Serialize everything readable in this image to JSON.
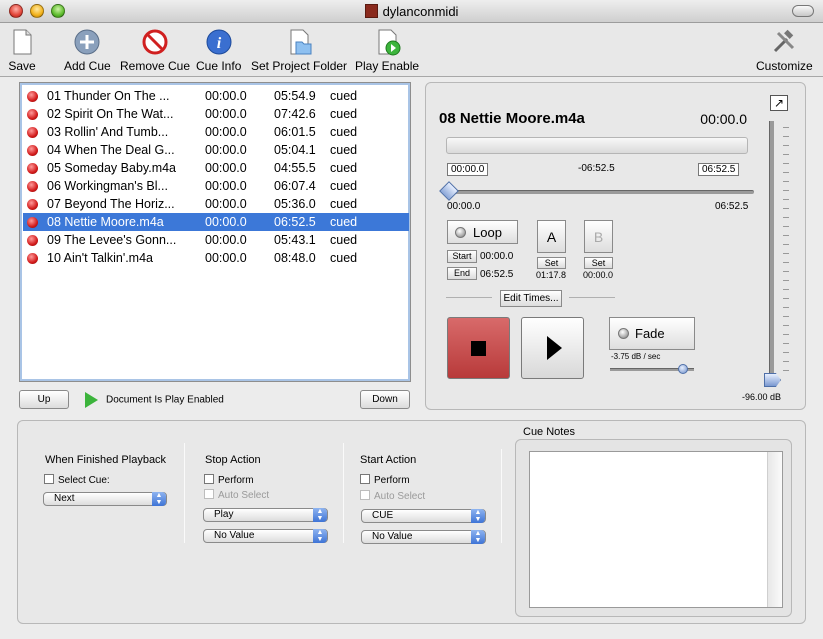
{
  "window": {
    "title": "dylanconmidi"
  },
  "toolbar": {
    "save": "Save",
    "add_cue": "Add Cue",
    "remove_cue": "Remove Cue",
    "cue_info": "Cue Info",
    "set_project_folder": "Set Project Folder",
    "play_enable": "Play Enable",
    "customize": "Customize"
  },
  "cues": [
    {
      "name": "01 Thunder On The ...",
      "start": "00:00.0",
      "duration": "05:54.9",
      "status": "cued"
    },
    {
      "name": "02 Spirit On The Wat...",
      "start": "00:00.0",
      "duration": "07:42.6",
      "status": "cued"
    },
    {
      "name": "03 Rollin' And Tumb...",
      "start": "00:00.0",
      "duration": "06:01.5",
      "status": "cued"
    },
    {
      "name": "04 When The Deal G...",
      "start": "00:00.0",
      "duration": "05:04.1",
      "status": "cued"
    },
    {
      "name": "05 Someday Baby.m4a",
      "start": "00:00.0",
      "duration": "04:55.5",
      "status": "cued"
    },
    {
      "name": "06 Workingman's Bl...",
      "start": "00:00.0",
      "duration": "06:07.4",
      "status": "cued"
    },
    {
      "name": "07 Beyond The Horiz...",
      "start": "00:00.0",
      "duration": "05:36.0",
      "status": "cued"
    },
    {
      "name": "08 Nettie Moore.m4a",
      "start": "00:00.0",
      "duration": "06:52.5",
      "status": "cued"
    },
    {
      "name": "09 The Levee's Gonn...",
      "start": "00:00.0",
      "duration": "05:43.1",
      "status": "cued"
    },
    {
      "name": "10 Ain't Talkin'.m4a",
      "start": "00:00.0",
      "duration": "08:48.0",
      "status": "cued"
    }
  ],
  "selected_index": 7,
  "list_controls": {
    "up": "Up",
    "down": "Down",
    "play_status": "Document Is Play Enabled"
  },
  "player": {
    "track_name": "08 Nettie Moore.m4a",
    "current_time": "00:00.0",
    "progress_start": "00:00.0",
    "progress_remaining": "-06:52.5",
    "progress_end": "06:52.5",
    "scrub_start": "00:00.0",
    "scrub_end": "06:52.5",
    "loop_label": "Loop",
    "start_button": "Start",
    "start_time": "00:00.0",
    "end_button": "End",
    "end_time": "06:52.5",
    "a_label": "A",
    "b_label": "B",
    "set_label": "Set",
    "a_time": "01:17.8",
    "b_time": "00:00.0",
    "edit_times": "Edit Times...",
    "fade_label": "Fade",
    "fade_rate": "-3.75 dB / sec",
    "volume_db": "-96.00 dB"
  },
  "when_finished": {
    "title": "When Finished Playback",
    "select_cue": "Select Cue:",
    "select_value": "Next"
  },
  "stop_action": {
    "title": "Stop Action",
    "perform": "Perform",
    "auto_select": "Auto Select",
    "action": "Play",
    "value": "No Value"
  },
  "start_action": {
    "title": "Start Action",
    "perform": "Perform",
    "auto_select": "Auto Select",
    "action": "CUE",
    "value": "No Value"
  },
  "cue_notes": {
    "title": "Cue Notes"
  },
  "colors": {
    "selection": "#3c78d8",
    "stop_button": "#c85050",
    "play_status": "#3cb43c"
  }
}
